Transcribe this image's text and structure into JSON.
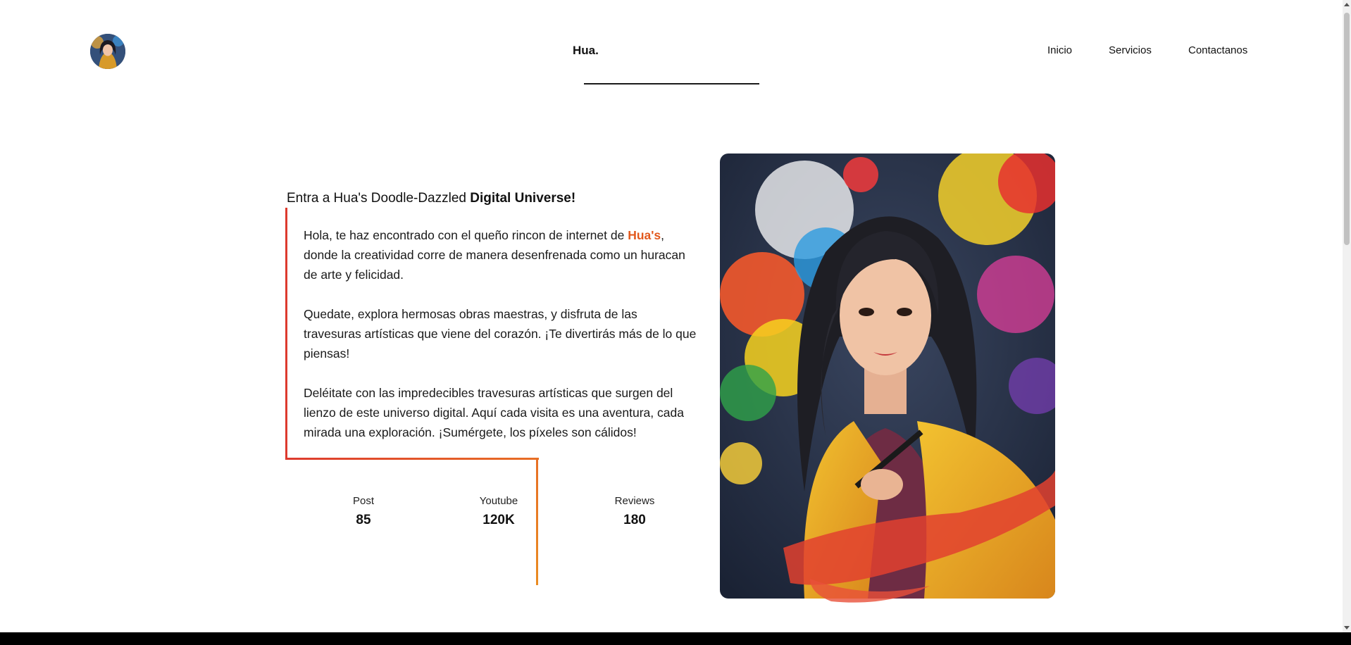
{
  "header": {
    "brand": "Hua.",
    "nav": [
      {
        "label": "Inicio"
      },
      {
        "label": "Servicios"
      },
      {
        "label": "Contactanos"
      }
    ]
  },
  "hero": {
    "title_plain": "Entra a Hua's Doodle-Dazzled ",
    "title_bold": "Digital Universe!",
    "p1_before": "Hola, te haz encontrado con el queño rincon de internet de ",
    "p1_highlight": "Hua's",
    "p1_after": ", donde la creatividad corre de manera desenfrenada como un huracan de arte y felicidad.",
    "p2": "Quedate, explora hermosas obras maestras, y disfruta de las travesuras artísticas que viene del corazón. ¡Te divertirás más de lo que piensas!",
    "p3": "Deléitate con las impredecibles travesuras artísticas que surgen del lienzo de este universo digital. Aquí cada visita es una aventura, cada mirada una exploración. ¡Sumérgete, los píxeles son cálidos!"
  },
  "stats": [
    {
      "label": "Post",
      "value": "85"
    },
    {
      "label": "Youtube",
      "value": "120K"
    },
    {
      "label": "Reviews",
      "value": "180"
    }
  ],
  "colors": {
    "accent_red": "#dd3a2e",
    "accent_orange": "#e86f25",
    "highlight": "#e2591d"
  }
}
